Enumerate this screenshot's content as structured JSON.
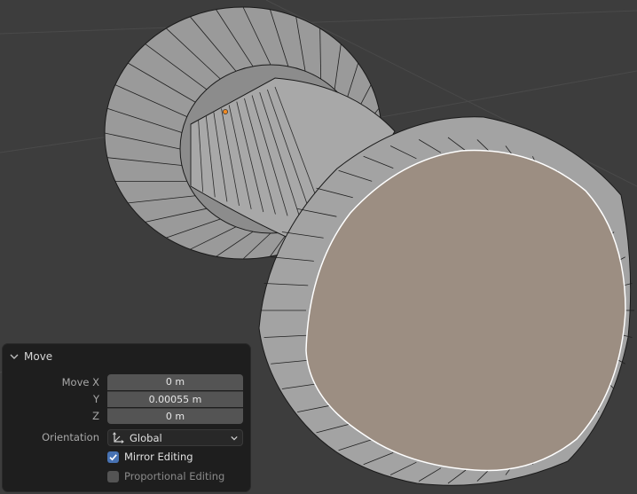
{
  "viewport": {
    "object": "spool-mesh",
    "colors": {
      "background": "#3d3d3d",
      "face": "#a0a0a0",
      "selected_face": "#9c8e82",
      "edge": "#1a1a1a",
      "selected_edge": "#ffffff",
      "origin": "#f08a24"
    }
  },
  "operator_panel": {
    "title": "Move",
    "move": {
      "label_x": "Move X",
      "label_y": "Y",
      "label_z": "Z",
      "x": "0 m",
      "y": "0.00055 m",
      "z": "0 m"
    },
    "orientation": {
      "label": "Orientation",
      "value": "Global",
      "icon": "orientation-global-icon"
    },
    "mirror_editing": {
      "label": "Mirror Editing",
      "checked": true
    },
    "proportional_editing": {
      "label": "Proportional Editing",
      "checked": false
    }
  }
}
